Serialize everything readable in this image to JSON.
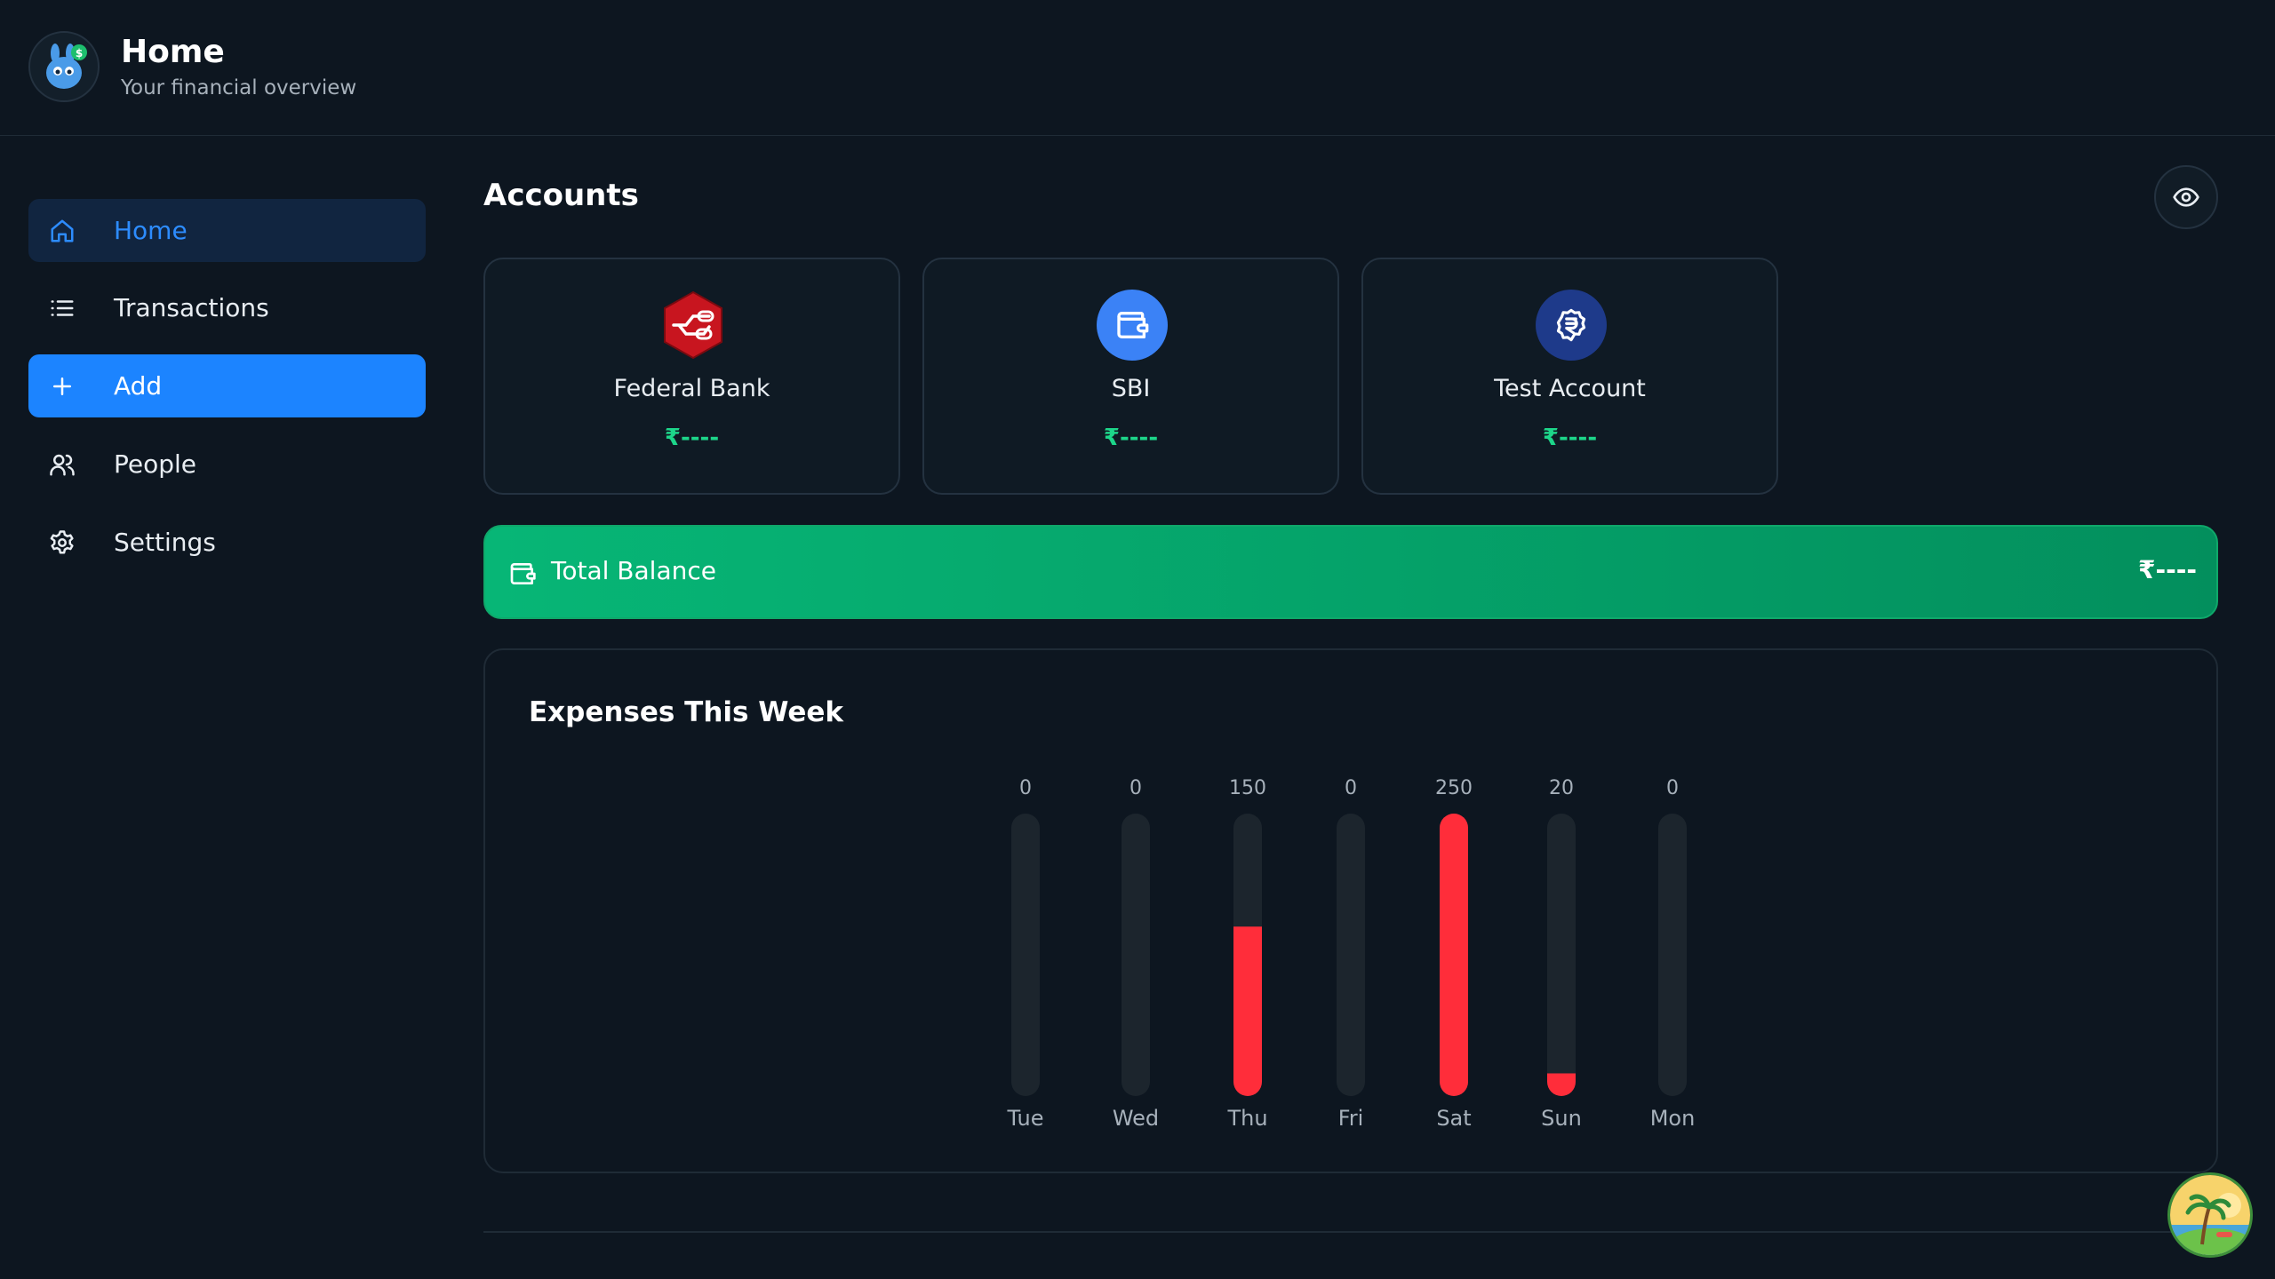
{
  "header": {
    "title": "Home",
    "subtitle": "Your financial overview",
    "logo_icon": "bunny-money-logo-icon"
  },
  "sidebar": {
    "items": [
      {
        "label": "Home",
        "icon": "home-icon",
        "active": true
      },
      {
        "label": "Transactions",
        "icon": "list-icon"
      },
      {
        "label": "Add",
        "icon": "plus-icon",
        "highlighted": true
      },
      {
        "label": "People",
        "icon": "people-icon"
      },
      {
        "label": "Settings",
        "icon": "gear-icon"
      }
    ]
  },
  "accounts": {
    "title": "Accounts",
    "visibility_icon": "eye-icon",
    "cards": [
      {
        "name": "Federal Bank",
        "balance": "₹----",
        "icon": "federal-bank-logo-icon",
        "color": "#c8151f"
      },
      {
        "name": "SBI",
        "balance": "₹----",
        "icon": "wallet-icon",
        "color": "#3b82f6"
      },
      {
        "name": "Test Account",
        "balance": "₹----",
        "icon": "rupee-badge-icon",
        "color": "#1e3a8a"
      }
    ]
  },
  "total_balance": {
    "label": "Total Balance",
    "value": "₹----",
    "icon": "wallet-icon"
  },
  "colors": {
    "accent": "#1c84ff",
    "balance_green": "#1dd68a",
    "expense_red": "#ff2d3a",
    "track": "#1c252d"
  },
  "chart_data": {
    "type": "bar",
    "title": "Expenses This Week",
    "categories": [
      "Tue",
      "Wed",
      "Thu",
      "Fri",
      "Sat",
      "Sun",
      "Mon"
    ],
    "values": [
      0,
      0,
      150,
      0,
      250,
      20,
      0
    ],
    "ylim": [
      0,
      250
    ],
    "grid": false
  }
}
